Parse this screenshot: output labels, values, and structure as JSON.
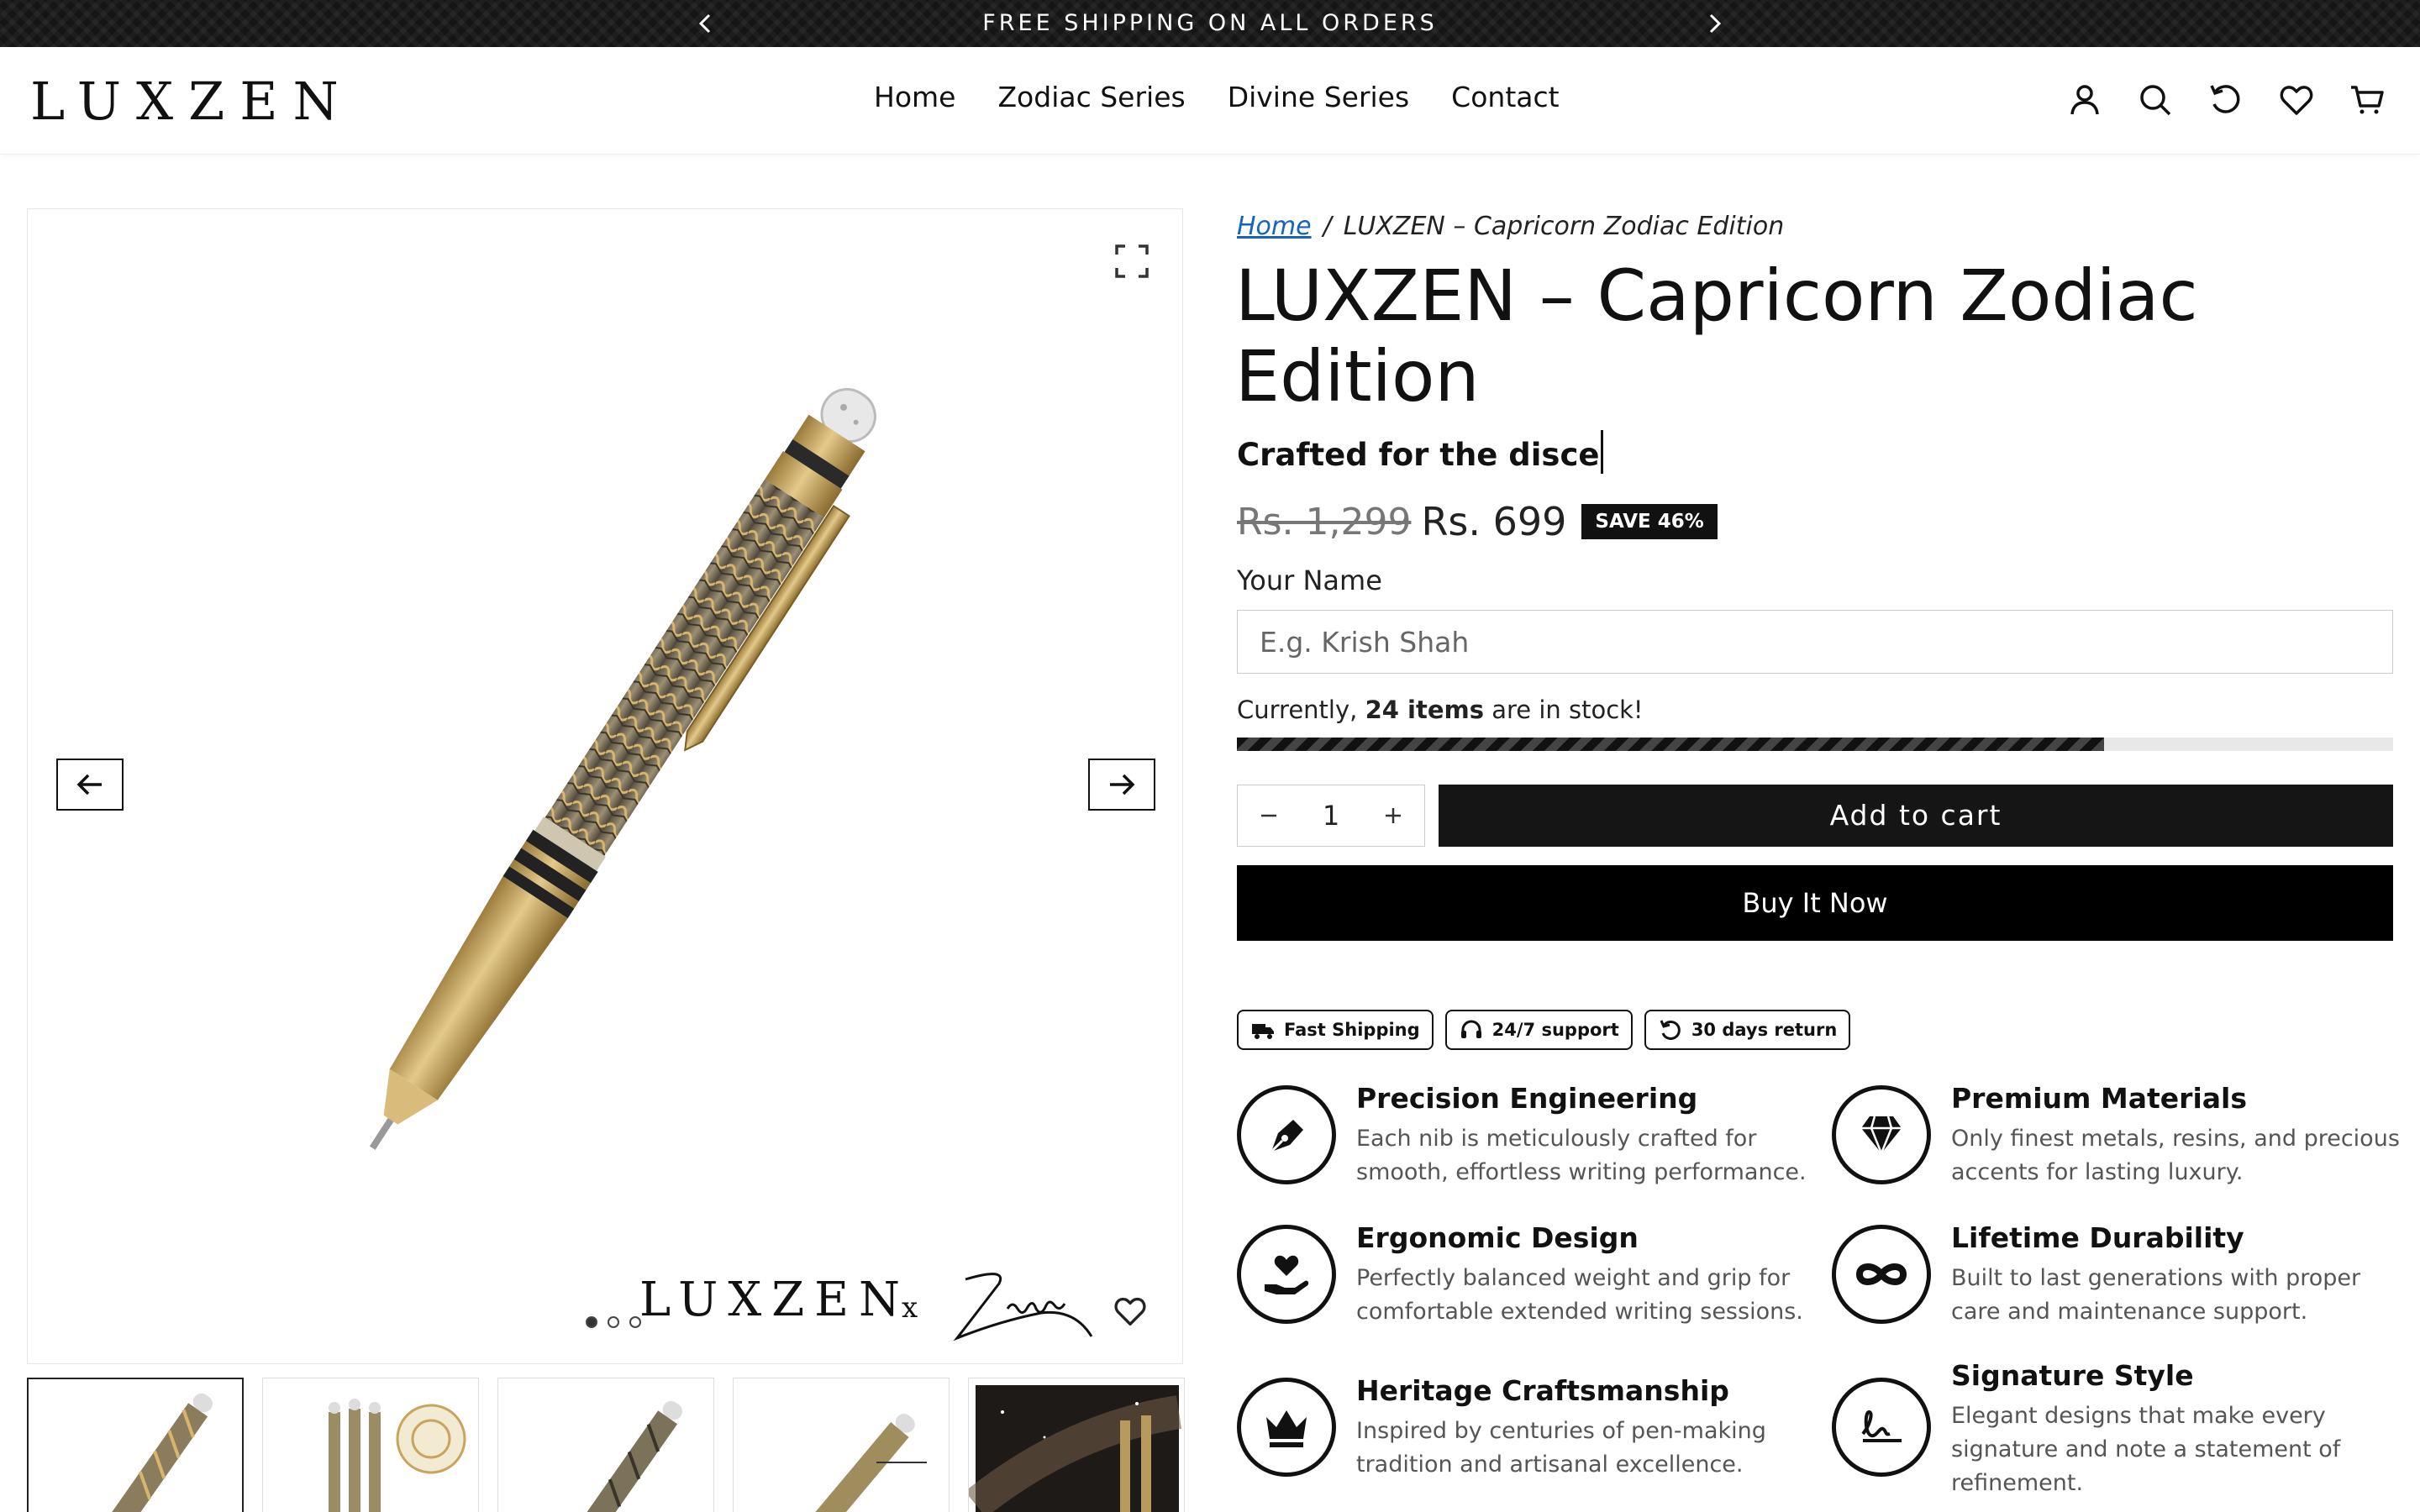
{
  "announcement": {
    "text": "FREE SHIPPING ON ALL ORDERS"
  },
  "header": {
    "logo": "LUXZEN",
    "nav": [
      "Home",
      "Zodiac Series",
      "Divine Series",
      "Contact"
    ]
  },
  "gallery": {
    "brand": "LUXZEN",
    "collab_x": "x",
    "slide_count": 3,
    "active_slide": 1,
    "thumb_count": 5
  },
  "breadcrumb": {
    "home": "Home",
    "sep": "/",
    "current": "LUXZEN – Capricorn Zodiac Edition"
  },
  "product": {
    "title": "LUXZEN – Capricorn Zodiac Edition",
    "tagline": "Crafted for the disce",
    "old_price": "Rs. 1,299",
    "price": "Rs. 699",
    "save_badge": "SAVE 46%"
  },
  "name_field": {
    "label": "Your Name",
    "placeholder": "E.g. Krish Shah"
  },
  "stock": {
    "prefix": "Currently,",
    "count_text": "24 items",
    "suffix": "are in stock!",
    "level_pct": 75
  },
  "quantity": {
    "value": "1"
  },
  "actions": {
    "add_to_cart": "Add to cart",
    "buy_now": "Buy It Now"
  },
  "pills": [
    "Fast Shipping",
    "24/7 support",
    "30 days return"
  ],
  "features": [
    {
      "title": "Precision Engineering",
      "desc": "Each nib is meticulously crafted for smooth, effortless writing performance.",
      "icon": "pen-nib-icon"
    },
    {
      "title": "Premium Materials",
      "desc": "Only finest metals, resins, and precious accents for lasting luxury.",
      "icon": "diamond-icon"
    },
    {
      "title": "Ergonomic Design",
      "desc": "Perfectly balanced weight and grip for comfortable extended writing sessions.",
      "icon": "hand-heart-icon"
    },
    {
      "title": "Lifetime Durability",
      "desc": "Built to last generations with proper care and maintenance support.",
      "icon": "infinity-icon"
    },
    {
      "title": "Heritage Craftsmanship",
      "desc": "Inspired by centuries of pen-making tradition and artisanal excellence.",
      "icon": "crown-icon"
    },
    {
      "title": "Signature Style",
      "desc": "Elegant designs that make every signature and note a statement of refinement.",
      "icon": "signature-icon"
    }
  ]
}
